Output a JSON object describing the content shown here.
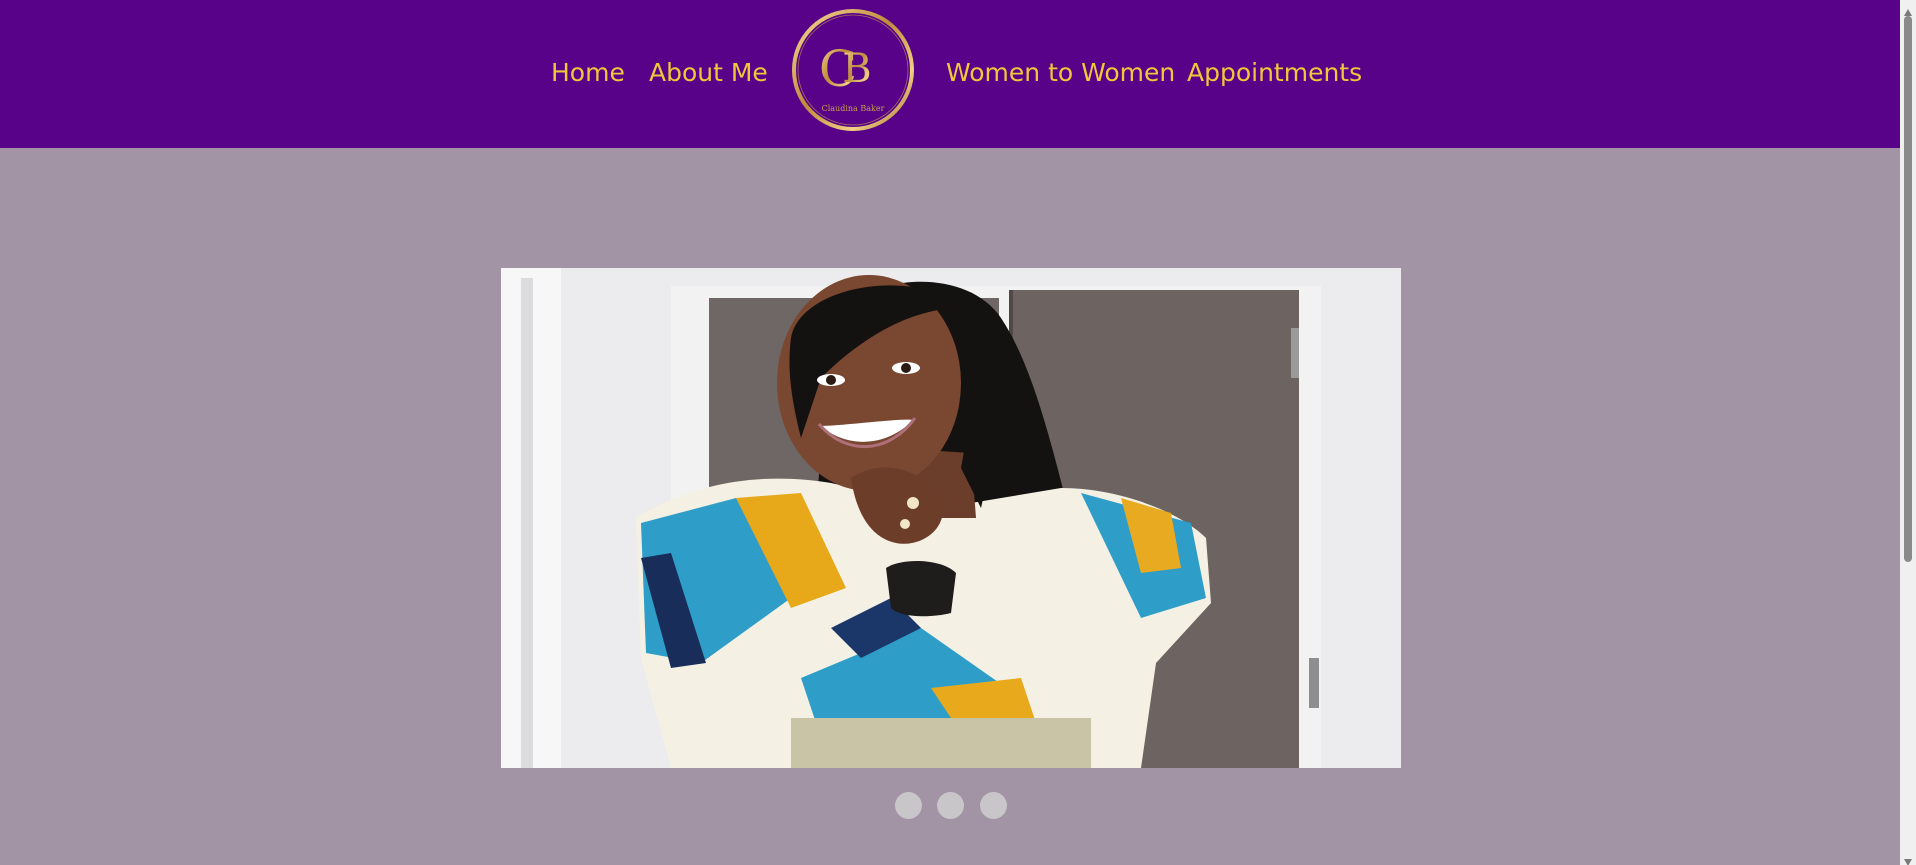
{
  "nav": {
    "home": "Home",
    "about": "About Me",
    "women": "Women to Women",
    "appointments": "Appointments"
  },
  "logo": {
    "monogram_c": "C",
    "monogram_b": "B",
    "name": "Claudina Baker"
  },
  "colors": {
    "header_bg": "#570289",
    "nav_text": "#f3c53a",
    "page_bg": "#a293a5",
    "gold": "#c9a04a",
    "dot": "#c9c6ca"
  },
  "slider": {
    "slide_count": 3,
    "dot_icon": "circle-dot"
  },
  "icons": {
    "scroll_up": "triangle-up-icon",
    "scroll_down": "triangle-down-icon"
  }
}
